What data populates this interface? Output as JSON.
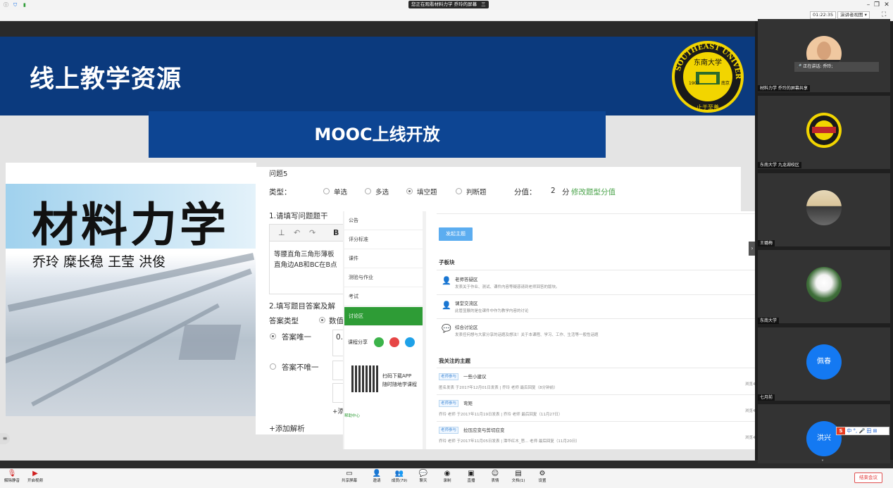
{
  "titlebar": {
    "title": "您正在观看材料力学 乔玲的屏幕",
    "title_icon": "三"
  },
  "infobar": {
    "timer": "01:22:35",
    "view_label": "演讲者视图"
  },
  "slide": {
    "title": "线上教学资源",
    "banner": "MOOC上线开放",
    "logo_text": "SOUTHEAST UNIVERSITY",
    "logo_cn": "东南大学",
    "logo_year": "1902",
    "logo_city": "南京",
    "logo_motto": "止于至善"
  },
  "cover": {
    "title": "材料力学",
    "authors": "乔玲  糜长稳  王莹  洪俊"
  },
  "question": {
    "heading": "问题5",
    "type_label": "类型：",
    "types": [
      "单选",
      "多选",
      "填空题",
      "判断题"
    ],
    "score_label": "分值：",
    "score_value": "2",
    "score_unit": "分",
    "score_link": "修改题型分值",
    "step1": "1.请填写问题题干",
    "stem_line1": "等腰直角三角形薄板",
    "stem_line2": "直角边AB和BC在B点",
    "step2": "2.填写题目答案及解",
    "answer_type_label": "答案类型",
    "answer_type_value": "数值",
    "answer_unique": "答案唯一",
    "answer_not_unique": "答案不唯一",
    "answer_value": "0.",
    "add_item": "+添",
    "add_analysis": "+添加解析"
  },
  "course": {
    "nav": [
      "公告",
      "评分标准",
      "课件",
      "测验与作业",
      "考试",
      "讨论区"
    ],
    "share_label": "课程分享",
    "qr_line1": "扫码下载APP",
    "qr_line2": "随时随地学课程",
    "help": "帮助中心",
    "post_button": "发起主题",
    "sub_title": "子板块",
    "boards": [
      {
        "name": "老师答疑区",
        "desc": "发表关于作业、测试、课件内容等疑惑请到老师回答的版块。"
      },
      {
        "name": "课堂交流区",
        "desc": "此管显展的是在课件中作为教学内容的讨论"
      },
      {
        "name": "综合讨论区",
        "desc": "发表任何想与大家分享的话题及想法！关于本课程、学习、工作、生活等一般性话题"
      }
    ],
    "follow_title": "我关注的主题",
    "topics": [
      {
        "tag": "老师参与",
        "title": "一些小建议",
        "meta": "匿名发表  于2017年12月01日发表  |  乔玲  老师  最后回复（8分钟前）",
        "right": "浏览4"
      },
      {
        "tag": "老师参与",
        "title": "弯矩",
        "meta": "乔玲  老师  于2017年11月19日发表  |  乔玲  老师  最后回复（11月27日）",
        "right": "浏览4"
      },
      {
        "tag": "老师参与",
        "title": "拉压应变与剪切应变",
        "meta": "乔玲  老师  于2017年11月05日发表  |  潭华红木_思...  老师  最后回复（11月20日）",
        "right": "浏览4"
      }
    ]
  },
  "participants": [
    {
      "label": "材料力学 乔玲的屏幕共享",
      "speaking": "正在讲话: 乔玲;"
    },
    {
      "label": "东南大学 九龙湖校区"
    },
    {
      "label": "王璐梅"
    },
    {
      "label": "东南大学"
    },
    {
      "label": "七月前",
      "initials": "佩春"
    },
    {
      "initials": "洪兴"
    }
  ],
  "ime": {
    "items": [
      "中",
      "°,",
      "🎤",
      "田",
      "⊞"
    ]
  },
  "toolbar": {
    "mute": "解除静音",
    "video": "开启视频",
    "tools": [
      "共享屏幕",
      "邀请",
      "成员(79)",
      "聊天",
      "录制",
      "直播",
      "表情",
      "文档(1)",
      "设置"
    ],
    "end": "结束会议"
  },
  "colors": {
    "header_blue": "#0b3a7e",
    "banner_blue": "#0d4593",
    "accent_green": "#2e9c36",
    "avatar_blue": "#1479f2",
    "end_red": "#e03030"
  }
}
